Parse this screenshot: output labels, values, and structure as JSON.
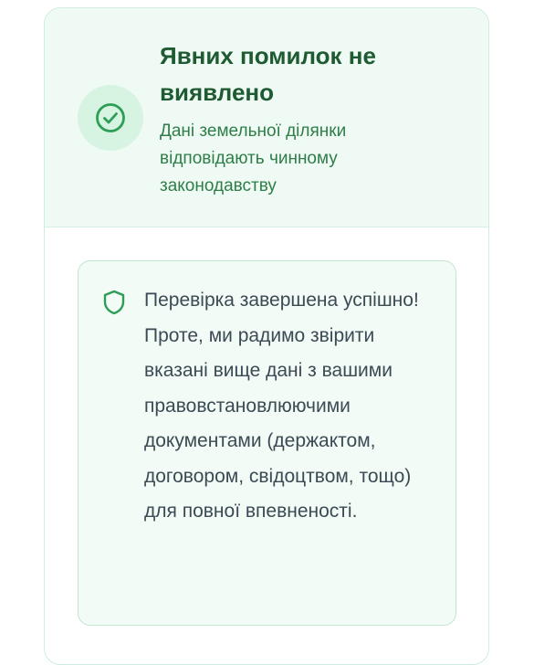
{
  "status": {
    "title": "Явних помилок не виявлено",
    "subtitle": "Дані земельної ділянки відповідають чинному законодавству",
    "icon": "check-circle-icon",
    "accent_color": "#2e9e56",
    "title_color": "#1f5b32",
    "subtitle_color": "#2f7d49",
    "header_background": "#eefaf3"
  },
  "notice": {
    "icon": "shield-icon",
    "text": "Перевірка завершена успішно! Проте, ми радимо звірити вказані вище дані з вашими правовстановлюючими документами (держактом, договором, свідоцтвом, тощо) для повної впевненості.",
    "background": "#f2fbf5",
    "border_color": "#bfe6cd",
    "text_color": "#3b4a55"
  }
}
